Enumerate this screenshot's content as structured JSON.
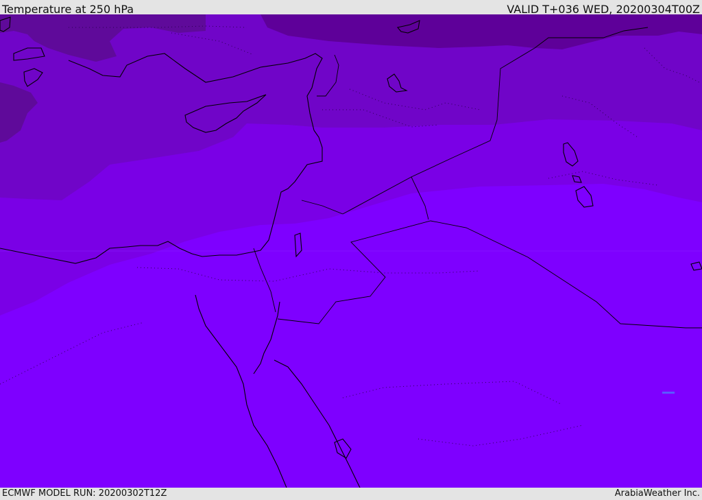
{
  "header": {
    "title": "Temperature at 250 hPa",
    "valid_time": "VALID T+036 WED, 20200304T00Z"
  },
  "footer": {
    "model_run": "ECMWF MODEL RUN: 20200302T12Z",
    "brand": "ArabiaWeather Inc."
  },
  "map": {
    "region": "Eastern Mediterranean, Levant, Egypt and Mesopotamia",
    "parameter": "Temperature",
    "level": "250 hPa",
    "colors": {
      "band_coldest": "#5e0099",
      "band_colder": "#6e0db8",
      "band_cold": "#7b00e0",
      "band_mild": "#7e00ff",
      "coastline": "#000000"
    }
  }
}
